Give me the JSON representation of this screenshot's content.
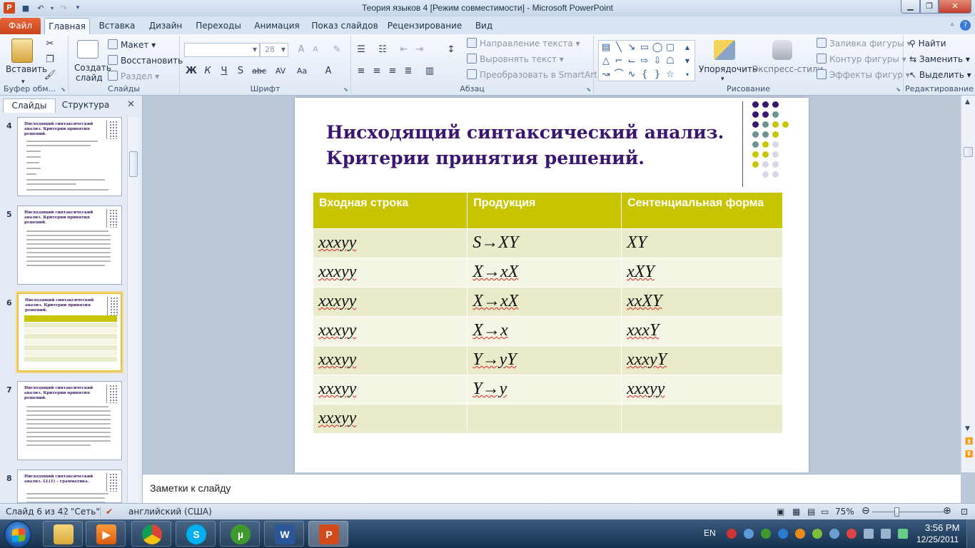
{
  "window": {
    "title": "Теория языков 4 [Режим совместимости]  -  Microsoft PowerPoint",
    "app_icon": "P"
  },
  "ribbon_tabs": [
    {
      "label": "Файл"
    },
    {
      "label": "Главная"
    },
    {
      "label": "Вставка"
    },
    {
      "label": "Дизайн"
    },
    {
      "label": "Переходы"
    },
    {
      "label": "Анимация"
    },
    {
      "label": "Показ слайдов"
    },
    {
      "label": "Рецензирование"
    },
    {
      "label": "Вид"
    }
  ],
  "ribbon": {
    "clipboard": {
      "paste": "Вставить",
      "label": "Буфер обм..."
    },
    "slides": {
      "create_line1": "Создать",
      "create_line2": "слайд",
      "layout": "Макет",
      "reset": "Восстановить",
      "section": "Раздел",
      "label": "Слайды"
    },
    "font": {
      "size": "28",
      "label": "Шрифт",
      "buttons": [
        "Ж",
        "К",
        "Ч",
        "S",
        "abc",
        "AV",
        "Aa",
        "A"
      ]
    },
    "paragraph": {
      "text_direction": "Направление текста",
      "align_text": "Выровнять текст",
      "smartart": "Преобразовать в SmartArt",
      "label": "Абзац"
    },
    "drawing": {
      "arrange": "Упорядочить",
      "quick_styles": "Экспресс-стили",
      "fill": "Заливка фигуры",
      "outline": "Контур фигуры",
      "effects": "Эффекты фигур",
      "label": "Рисование"
    },
    "editing": {
      "find": "Найти",
      "replace": "Заменить",
      "select": "Выделить",
      "label": "Редактирование"
    }
  },
  "left_panel": {
    "tab_slides": "Слайды",
    "tab_outline": "Структура",
    "thumbs": [
      {
        "num": "4",
        "title": "Нисходящий синтаксический анализ. Критерии принятия решений."
      },
      {
        "num": "5",
        "title": "Нисходящий синтаксический анализ. Критерии принятия решений."
      },
      {
        "num": "6",
        "title": "Нисходящий синтаксический анализ. Критерии принятия решений."
      },
      {
        "num": "7",
        "title": "Нисходящий синтаксический анализ. Критерии принятия решений."
      },
      {
        "num": "8",
        "title": "Нисходящий синтаксический анализ. LL(1) – грамматика."
      }
    ]
  },
  "slide": {
    "title_line1": "Нисходящий синтаксический  анализ.",
    "title_line2": "Критерии принятия  решений.",
    "table": {
      "headers": [
        "Входная строка",
        "Продукция",
        "Сентенциальная форма"
      ],
      "rows": [
        [
          "xxxyy",
          "S→XY",
          "XY"
        ],
        [
          "xxxyy",
          "X→xX",
          "xXY"
        ],
        [
          "xxxyy",
          "X→xX",
          "xxXY"
        ],
        [
          "xxxyy",
          "X→x",
          "xxxY"
        ],
        [
          "xxxyy",
          "Y→yY",
          "xxxyY"
        ],
        [
          "xxxyy",
          "Y→y",
          "xxxyy"
        ],
        [
          "xxxyy",
          "",
          ""
        ]
      ]
    }
  },
  "notes": {
    "placeholder": "Заметки к слайду"
  },
  "status": {
    "slide_info": "Слайд 6 из 42",
    "theme": "\"Сеть\"",
    "language": "английский (США)",
    "zoom": "75%"
  },
  "taskbar": {
    "lang": "EN",
    "time": "3:56 PM",
    "date": "12/25/2011",
    "word_icon": "W",
    "ppt_icon": "P"
  },
  "colors": {
    "accent_yellow": "#c9c400",
    "title_purple": "#3a1670",
    "file_tab": "#d04a1a"
  }
}
